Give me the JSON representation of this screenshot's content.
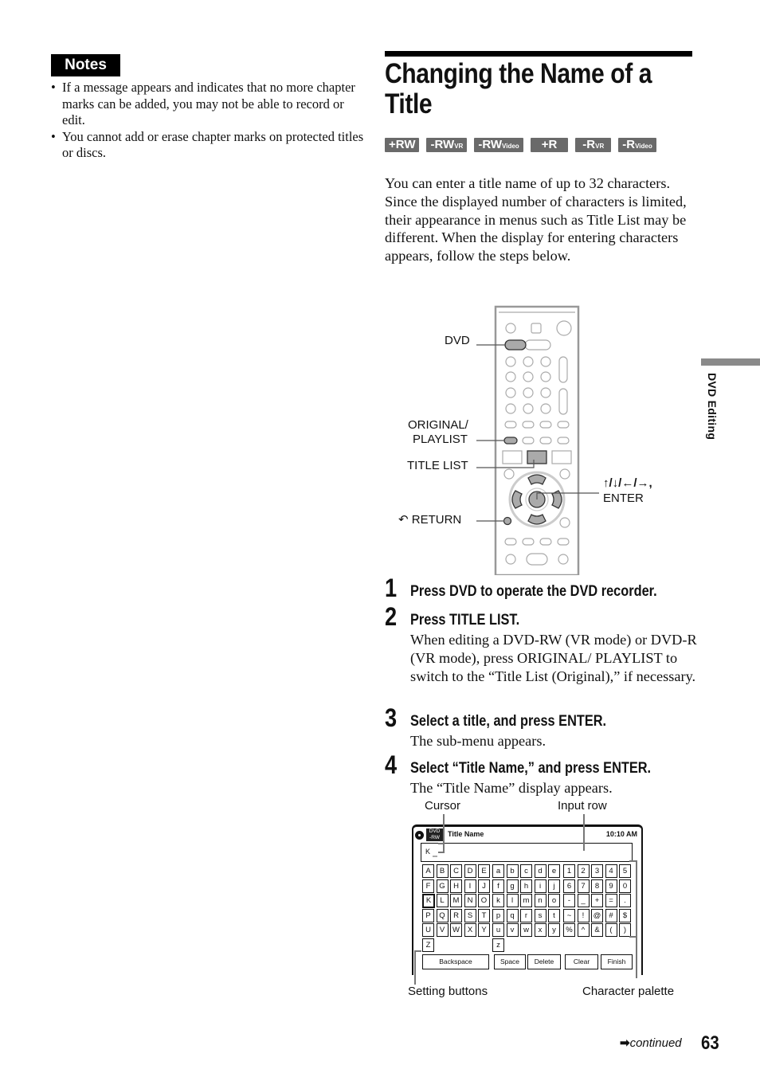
{
  "notes": {
    "heading": "Notes",
    "items": [
      "If a message appears and indicates that no more chapter marks can be added, you may not be able to record or edit.",
      "You cannot add or erase chapter marks on protected titles or discs."
    ]
  },
  "page_title": "Changing the Name of a Title",
  "disc_badges": [
    {
      "main": "+RW",
      "sub": ""
    },
    {
      "main": "-RW",
      "sub": "VR"
    },
    {
      "main": "-RW",
      "sub": "Video"
    },
    {
      "main": "+R",
      "sub": ""
    },
    {
      "main": "-R",
      "sub": "VR"
    },
    {
      "main": "-R",
      "sub": "Video"
    }
  ],
  "intro": "You can enter a title name of up to 32 characters. Since the displayed number of characters is limited, their appearance in menus such as Title List may be different. When the display for entering characters appears, follow the steps below.",
  "remote_labels": {
    "dvd": "DVD",
    "original_playlist_1": "ORIGINAL/",
    "original_playlist_2": "PLAYLIST",
    "title_list": "TITLE LIST",
    "return": "RETURN",
    "arrows": "↑/↓/←/→,",
    "enter": "ENTER"
  },
  "steps": [
    {
      "num": "1",
      "heading": "Press DVD to operate the DVD recorder.",
      "body": ""
    },
    {
      "num": "2",
      "heading": "Press TITLE LIST.",
      "body": "When editing a DVD-RW (VR mode) or DVD-R (VR mode), press ORIGINAL/ PLAYLIST to switch to the “Title List (Original),” if necessary."
    },
    {
      "num": "3",
      "heading": "Select a title, and press ENTER.",
      "body": "The sub-menu appears."
    },
    {
      "num": "4",
      "heading": "Select “Title Name,” and press ENTER.",
      "body": "The “Title Name” display appears."
    }
  ],
  "screen": {
    "callouts": {
      "cursor": "Cursor",
      "input_row": "Input row",
      "setting_buttons": "Setting buttons",
      "character_palette": "Character palette"
    },
    "disc_icon": "DVD\n-RW",
    "disc_line1": "DVD",
    "disc_line2": "-RW",
    "title": "Title Name",
    "clock": "10:10 AM",
    "input_value": "K",
    "palette": [
      [
        "A",
        "B",
        "C",
        "D",
        "E",
        "a",
        "b",
        "c",
        "d",
        "e",
        "1",
        "2",
        "3",
        "4",
        "5"
      ],
      [
        "F",
        "G",
        "H",
        "I",
        "J",
        "f",
        "g",
        "h",
        "i",
        "j",
        "6",
        "7",
        "8",
        "9",
        "0"
      ],
      [
        "K",
        "L",
        "M",
        "N",
        "O",
        "k",
        "l",
        "m",
        "n",
        "o",
        "-",
        "_",
        "+",
        "=",
        "."
      ],
      [
        "P",
        "Q",
        "R",
        "S",
        "T",
        "p",
        "q",
        "r",
        "s",
        "t",
        "~",
        "!",
        "@",
        "#",
        "$"
      ],
      [
        "U",
        "V",
        "W",
        "X",
        "Y",
        "u",
        "v",
        "w",
        "x",
        "y",
        "%",
        "^",
        "&",
        "(",
        ")"
      ],
      [
        "Z",
        "",
        "",
        "",
        "",
        "z",
        "",
        "",
        "",
        "",
        "",
        "",
        "",
        "",
        ""
      ]
    ],
    "selected_key": "K",
    "buttons": [
      "Backspace",
      "Space",
      "Delete",
      "Clear",
      "Finish"
    ]
  },
  "side_tab": "DVD Editing",
  "footer": {
    "continued": "continued",
    "page_number": "63"
  }
}
